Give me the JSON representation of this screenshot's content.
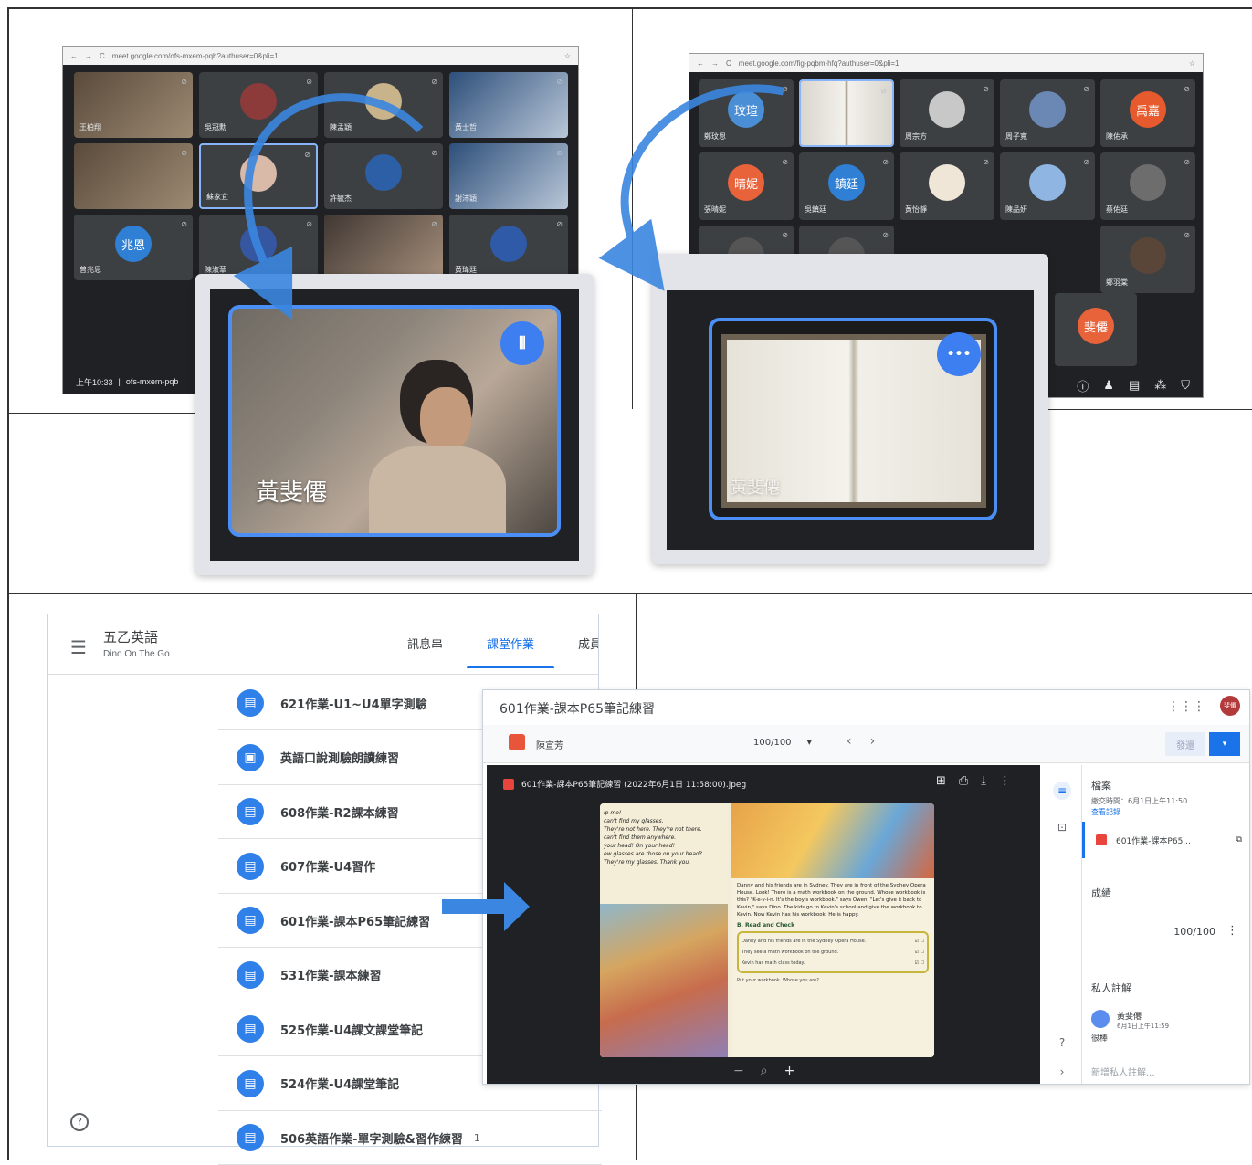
{
  "meet_left": {
    "url": "meet.google.com/ofs-mxem-pqb?authuser=0&pli=1",
    "clock": "上午10:33",
    "code": "ofs-mxem-pqb",
    "tiles": [
      {
        "name": "王柏翔",
        "kind": "photo",
        "avatar": ""
      },
      {
        "name": "吳冠勳",
        "kind": "avatar",
        "avatar": "",
        "color": "#8d3a3a"
      },
      {
        "name": "陳孟穎",
        "kind": "avatar",
        "avatar": "",
        "color": "#c8b38a"
      },
      {
        "name": "黃士哲",
        "kind": "photo",
        "avatar": ""
      },
      {
        "name": "",
        "kind": "photo",
        "avatar": ""
      },
      {
        "name": "蘇家宜",
        "kind": "avatar",
        "avatar": "",
        "color": "#d9b9a8"
      },
      {
        "name": "許毓杰",
        "kind": "avatar",
        "avatar": "",
        "color": "#2d5fa6"
      },
      {
        "name": "謝沛穎",
        "kind": "photo",
        "avatar": ""
      },
      {
        "name": "曾兆恩",
        "kind": "avatar",
        "avatar": "兆恩",
        "color": "#2f7fd4"
      },
      {
        "name": "陳淑華",
        "kind": "avatar",
        "avatar": "",
        "color": "#3556a0"
      },
      {
        "name": "",
        "kind": "photo",
        "avatar": ""
      },
      {
        "name": "黃瑋廷",
        "kind": "avatar",
        "avatar": "",
        "color": "#2e5aa8"
      }
    ]
  },
  "meet_right": {
    "url": "meet.google.com/fig-pqbm-hfq?authuser=0&pli=1",
    "tiles": [
      {
        "name": "鄭玟恩",
        "avatar": "玟瑄",
        "color": "#4a8fd6"
      },
      {
        "name": "",
        "avatar": "",
        "color": "#ffffff"
      },
      {
        "name": "周宗方",
        "avatar": "",
        "color": "#c8c8c8"
      },
      {
        "name": "周子寬",
        "avatar": "",
        "color": "#6b88b5"
      },
      {
        "name": "陳佑承",
        "avatar": "禹嘉",
        "color": "#e65a2e"
      },
      {
        "name": "張晴妮",
        "avatar": "晴妮",
        "color": "#e8623a"
      },
      {
        "name": "吳鎮廷",
        "avatar": "鎮廷",
        "color": "#2f7fd4"
      },
      {
        "name": "黃怡靜",
        "avatar": "",
        "color": "#efe6d8"
      },
      {
        "name": "陳品妍",
        "avatar": "",
        "color": "#8fb6e2"
      },
      {
        "name": "蔡佑廷",
        "avatar": "",
        "color": "#6d6d6d"
      },
      {
        "name": "",
        "avatar": "",
        "color": "#555"
      },
      {
        "name": "",
        "avatar": "",
        "color": "#555"
      },
      {
        "name": "",
        "avatar": "",
        "color": "#555"
      },
      {
        "name": "",
        "avatar": "",
        "color": "#555"
      },
      {
        "name": "鄭羽棠",
        "avatar": "",
        "color": "#5a4638"
      }
    ],
    "presenter_avatar": "斐僊",
    "toolbar_icons": [
      "info-icon",
      "people-icon",
      "chat-icon",
      "activities-icon",
      "lock-icon"
    ]
  },
  "zoom_left": {
    "caption": "黃斐僊",
    "badge_icon": "speaking-icon"
  },
  "zoom_right": {
    "caption": "黃斐僊",
    "badge_icon": "more-icon"
  },
  "classroom": {
    "course_title": "五乙英語",
    "course_sub": "Dino On The Go",
    "tabs": [
      "訊息串",
      "課堂作業",
      "成員"
    ],
    "active_tab": 1,
    "assignments": [
      {
        "label": "621作業-U1~U4單字測驗",
        "icon": "assignment-icon",
        "count": ""
      },
      {
        "label": "英語口說測驗朗讀練習",
        "icon": "save-icon",
        "count": ""
      },
      {
        "label": "608作業-R2課本練習",
        "icon": "assignment-icon",
        "count": ""
      },
      {
        "label": "607作業-U4習作",
        "icon": "assignment-icon",
        "count": ""
      },
      {
        "label": "601作業-課本P65筆記練習",
        "icon": "assignment-icon",
        "count": ""
      },
      {
        "label": "531作業-課本練習",
        "icon": "assignment-icon",
        "count": ""
      },
      {
        "label": "525作業-U4課文課堂筆記",
        "icon": "assignment-icon",
        "count": ""
      },
      {
        "label": "524作業-U4課堂筆記",
        "icon": "assignment-icon",
        "count": ""
      },
      {
        "label": "506英語作業-單字測驗&習作練習",
        "icon": "assignment-icon",
        "count": "1"
      }
    ]
  },
  "grader": {
    "title": "601作業-課本P65筆記練習",
    "student": "陳宣芳",
    "grade": "100/100",
    "return_label": "發還",
    "file_name": "601作業-課本P65筆記練習 (2022年6月1日 11:58:00).jpeg",
    "side": {
      "files_heading": "檔案",
      "submitted": "繳交時間：6月1日上午11:50",
      "history": "查看記錄",
      "file_short": "601作業-課本P65...",
      "grade_heading": "成績",
      "grade": "100/100",
      "comment_heading": "私人註解",
      "commenter": "黃斐僊",
      "comment_time": "6月1日上午11:59",
      "comment": "很棒",
      "comment_placeholder": "新增私人註解..."
    },
    "book_text": {
      "left_lines": [
        "ip me!",
        "can't find my glasses.",
        "They're not here. They're not there.",
        "can't find them anywhere.",
        "your head! On your head!",
        "ew glasses are those on your head?",
        "They're my glasses. Thank you."
      ],
      "right_para": "Danny and his friends are in Sydney. They are in front of the Sydney Opera House. Look! There is a math workbook on the ground. Whose workbook is this? \"K-e-v-i-n. It's the boy's workbook.\" says Owen. \"Let's give it back to Kevin,\" says Dino. The kids go to Kevin's school and give the workbook to Kevin. Now Kevin has his workbook. He is happy.",
      "check_title": "B. Read and Check",
      "check_items": [
        "Danny and his friends are in the Sydney Opera House.",
        "They see a math workbook on the ground.",
        "Kevin has math class today."
      ],
      "footer": "Put your workbook. Whose you are?"
    }
  }
}
